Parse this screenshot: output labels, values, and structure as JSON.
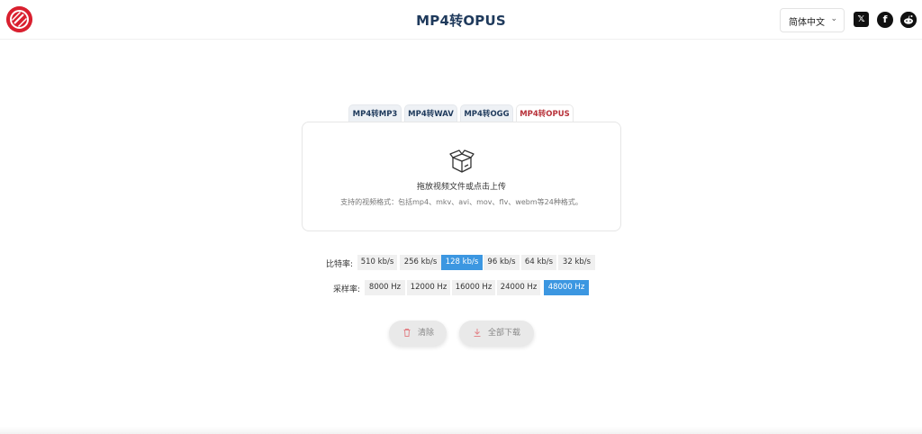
{
  "header": {
    "title": "MP4转OPUS",
    "language": "简体中文",
    "language_chevron": "⌄",
    "social": {
      "x": "𝕏",
      "facebook": "f",
      "reddit": "●"
    }
  },
  "tabs": [
    {
      "label": "MP4转MP3",
      "active": false
    },
    {
      "label": "MP4转WAV",
      "active": false
    },
    {
      "label": "MP4转OGG",
      "active": false
    },
    {
      "label": "MP4转OPUS",
      "active": true
    }
  ],
  "upload": {
    "icon": "open-box-icon",
    "title": "拖放视频文件或点击上传",
    "hint": "支持的视频格式：包括mp4、mkv、avi、mov、flv、webm等24种格式。"
  },
  "bitrate": {
    "label": "比特率:",
    "options": [
      "510 kb/s",
      "256 kb/s",
      "128 kb/s",
      "96 kb/s",
      "64 kb/s",
      "32 kb/s"
    ],
    "selected": "128 kb/s"
  },
  "samplerate": {
    "label": "采样率:",
    "options": [
      "8000 Hz",
      "12000 Hz",
      "16000 Hz",
      "24000 Hz",
      "48000 Hz"
    ],
    "selected": "48000 Hz"
  },
  "actions": {
    "clear_label": "清除",
    "download_label": "全部下载"
  },
  "colors": {
    "accent_blue": "#3c97e1",
    "title_navy": "#1f3a5c",
    "active_tab_red": "#b8323a",
    "logo_red": "#d9202f"
  }
}
